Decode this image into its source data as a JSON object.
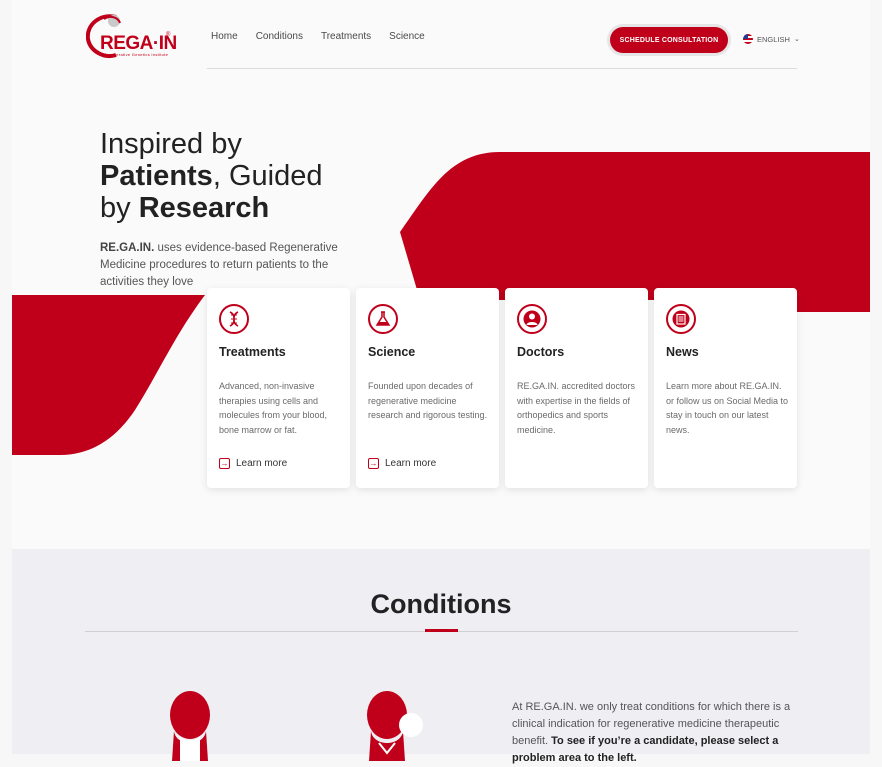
{
  "header": {
    "logo_text": "REGA·IN",
    "logo_tagline": "Regenerative Genetics Institute",
    "nav": [
      "Home",
      "Conditions",
      "Treatments",
      "Science"
    ],
    "cta_label": "SCHEDULE CONSULTATION",
    "language": "ENGLISH"
  },
  "hero": {
    "title_line1": "Inspired by",
    "title_bold1": "Patients",
    "title_line2_rest": ", Guided",
    "title_line3_pre": "by ",
    "title_bold2": "Research",
    "sub_brand": "RE.GA.IN.",
    "sub_text": " uses evidence-based Regenerative Medicine procedures to return patients to the activities they love"
  },
  "cards": [
    {
      "icon": "dna-icon",
      "title": "Treatments",
      "text": "Advanced, non-invasive therapies using cells and molecules from your blood, bone marrow or fat.",
      "link": "Learn more"
    },
    {
      "icon": "flask-icon",
      "title": "Science",
      "text": "Founded upon decades of regenerative medicine research and rigorous testing.",
      "link": "Learn more"
    },
    {
      "icon": "doctor-icon",
      "title": "Doctors",
      "text": "RE.GA.IN. accredited doctors with expertise in the fields of orthopedics and sports medicine.",
      "link": ""
    },
    {
      "icon": "news-icon",
      "title": "News",
      "text": "Learn more about RE.GA.IN. or follow us on Social Media to stay in touch on our latest news.",
      "link": ""
    }
  ],
  "conditions": {
    "title": "Conditions",
    "text_plain": "At RE.GA.IN. we only treat conditions for which there is a clinical indication for regenerative medicine therapeutic benefit. ",
    "text_bold": "To see if you’re a candidate, please select a problem area to the left."
  },
  "colors": {
    "accent": "#c0001a",
    "background": "#fafafa",
    "section_bg": "#efeff3"
  }
}
